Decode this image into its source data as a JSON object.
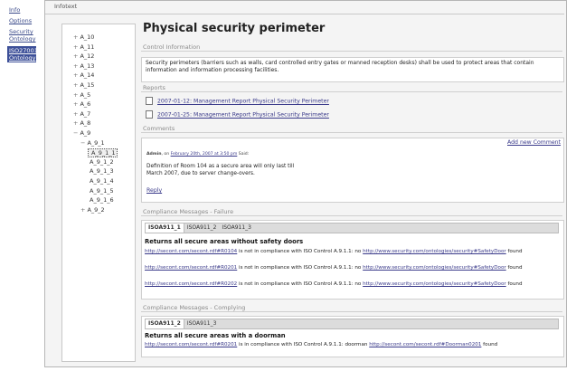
{
  "nav": {
    "items": [
      "Info",
      "Options",
      "Security Ontology",
      "ISO27001 Ontology"
    ]
  },
  "topbar": {
    "title": "Infotext"
  },
  "tree": {
    "items": [
      {
        "label": "A_10",
        "pm": "+"
      },
      {
        "label": "A_11",
        "pm": "+"
      },
      {
        "label": "A_12",
        "pm": "+"
      },
      {
        "label": "A_13",
        "pm": "+"
      },
      {
        "label": "A_14",
        "pm": "+"
      },
      {
        "label": "A_15",
        "pm": "+"
      },
      {
        "label": "A_5",
        "pm": "+"
      },
      {
        "label": "A_6",
        "pm": "+"
      },
      {
        "label": "A_7",
        "pm": "+"
      },
      {
        "label": "A_8",
        "pm": "+"
      },
      {
        "label": "A_9",
        "pm": "−"
      },
      {
        "label": "A_9_1",
        "pm": "−"
      },
      {
        "label": "A_9_1_1",
        "pm": ""
      },
      {
        "label": "A_9_1_2",
        "pm": ""
      },
      {
        "label": "A_9_1_3",
        "pm": ""
      },
      {
        "label": "A_9_1_4",
        "pm": ""
      },
      {
        "label": "A_9_1_5",
        "pm": ""
      },
      {
        "label": "A_9_1_6",
        "pm": ""
      },
      {
        "label": "A_9_2",
        "pm": "+"
      }
    ]
  },
  "page": {
    "title": "Physical security perimeter",
    "control_info_heading": "Control Information",
    "control_info_text": "Security perimeters (barriers such as walls, card controlled entry gates or manned reception desks) shall be used to protect areas that contain information and information processing facilities.",
    "reports_heading": "Reports",
    "reports": [
      "2007-01-12: Management Report Physical Security Perimeter",
      "2007-01-25: Management Report Physical Security Perimeter"
    ],
    "comments_heading": "Comments",
    "add_comment": "Add new Comment",
    "comment_author": "Admin",
    "comment_on": ", on",
    "comment_date": "February 20th, 2007 at 3:50 pm",
    "comment_said": "Said:",
    "comment_body": "Definition of Room 104 as a secure area will only last till March 2007, due to server change-overs.",
    "reply": "Reply",
    "fail_heading": "Compliance Messages - Failure",
    "fail_tabs": [
      "ISOA911_1",
      "ISOA911_2",
      "ISOA911_3"
    ],
    "fail_rule_title": "Returns all secure areas without safety doors",
    "fail_messages": [
      {
        "a": "http://secont.com/secont.rdf#R0104",
        "b": " is not in compliance with ISO Control A.9.1.1: no ",
        "c": "http://www.security.com/ontologies/security#SafetyDoor",
        "d": " found"
      },
      {
        "a": "http://secont.com/secont.rdf#R0201",
        "b": " is not in compliance with ISO Control A.9.1.1: no ",
        "c": "http://www.security.com/ontologies/security#SafetyDoor",
        "d": " found"
      },
      {
        "a": "http://secont.com/secont.rdf#R0202",
        "b": " is not in compliance with ISO Control A.9.1.1: no ",
        "c": "http://www.security.com/ontologies/security#SafetyDoor",
        "d": " found"
      }
    ],
    "comply_heading": "Compliance Messages - Complying",
    "comply_tabs": [
      "ISOA911_2",
      "ISOA911_3"
    ],
    "comply_rule_title": "Returns all secure areas with a doorman",
    "comply_messages": [
      {
        "a": "http://secont.com/secont.rdf#R0201",
        "b": " is in compliance with ISO Control A.9.1.1: doorman ",
        "c": "http://secont.com/secont.rdf#Doorman0201",
        "d": " found"
      }
    ]
  }
}
